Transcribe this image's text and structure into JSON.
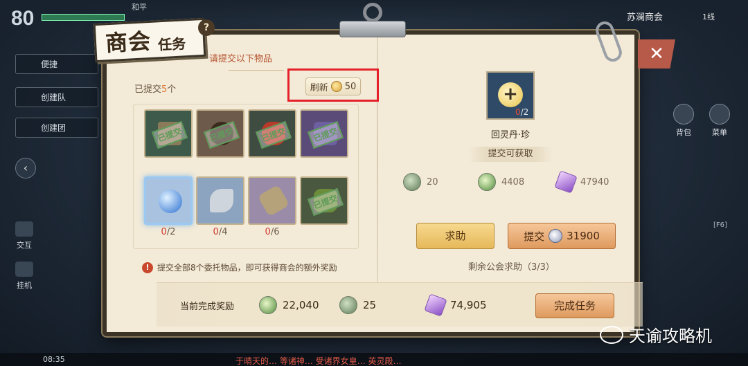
{
  "hud": {
    "level": "80",
    "zone": "和平",
    "server_zone": "苏澜商会",
    "line": "1线",
    "menu": [
      "便捷",
      "创建队",
      "创建团"
    ],
    "left_side": [
      "交互",
      "挂机"
    ],
    "right_side": [
      "背包",
      "菜单"
    ],
    "f6": "[F6]",
    "clock": "08:35",
    "ticker": "于晴天的… 等诸神… 受诸界女皇… 英灵殿…"
  },
  "title": {
    "main": "商会",
    "sub": "任务",
    "help": "?"
  },
  "left_page": {
    "header": "请提交以下物品",
    "submitted_prefix": "已提交",
    "submitted_count": "5",
    "submitted_suffix": "个",
    "refresh_label": "刷新",
    "refresh_cost": "50",
    "stamp_text": "已提交",
    "counts": [
      {
        "have": "0",
        "need": "/2"
      },
      {
        "have": "0",
        "need": "/4"
      },
      {
        "have": "0",
        "need": "/6"
      }
    ],
    "warning": "提交全部8个委托物品，即可获得商会的额外奖励"
  },
  "right_page": {
    "target_have": "0",
    "target_need": "/2",
    "target_name": "回灵丹·珍",
    "reward_label": "提交可获取",
    "rewards": [
      {
        "icon": "repute-icon",
        "value": "20"
      },
      {
        "icon": "exp-icon",
        "value": "4408"
      },
      {
        "icon": "crystal-icon",
        "value": "47940"
      }
    ],
    "help_label": "求助",
    "submit_label": "提交",
    "submit_cost": "31900",
    "remaining": "剩余公会求助（3/3）"
  },
  "bottom": {
    "label": "当前完成奖励",
    "rewards": [
      {
        "icon": "exp-icon",
        "value": "22,040"
      },
      {
        "icon": "repute-icon",
        "value": "25"
      },
      {
        "icon": "crystal-icon",
        "value": "74,905"
      }
    ],
    "complete_label": "完成任务"
  },
  "watermark": "天谕攻略机",
  "colors": {
    "accent_red": "#e5202a",
    "paper": "#f3ead8",
    "button_orange": "#de9a5e",
    "button_gold": "#e6b85a"
  }
}
